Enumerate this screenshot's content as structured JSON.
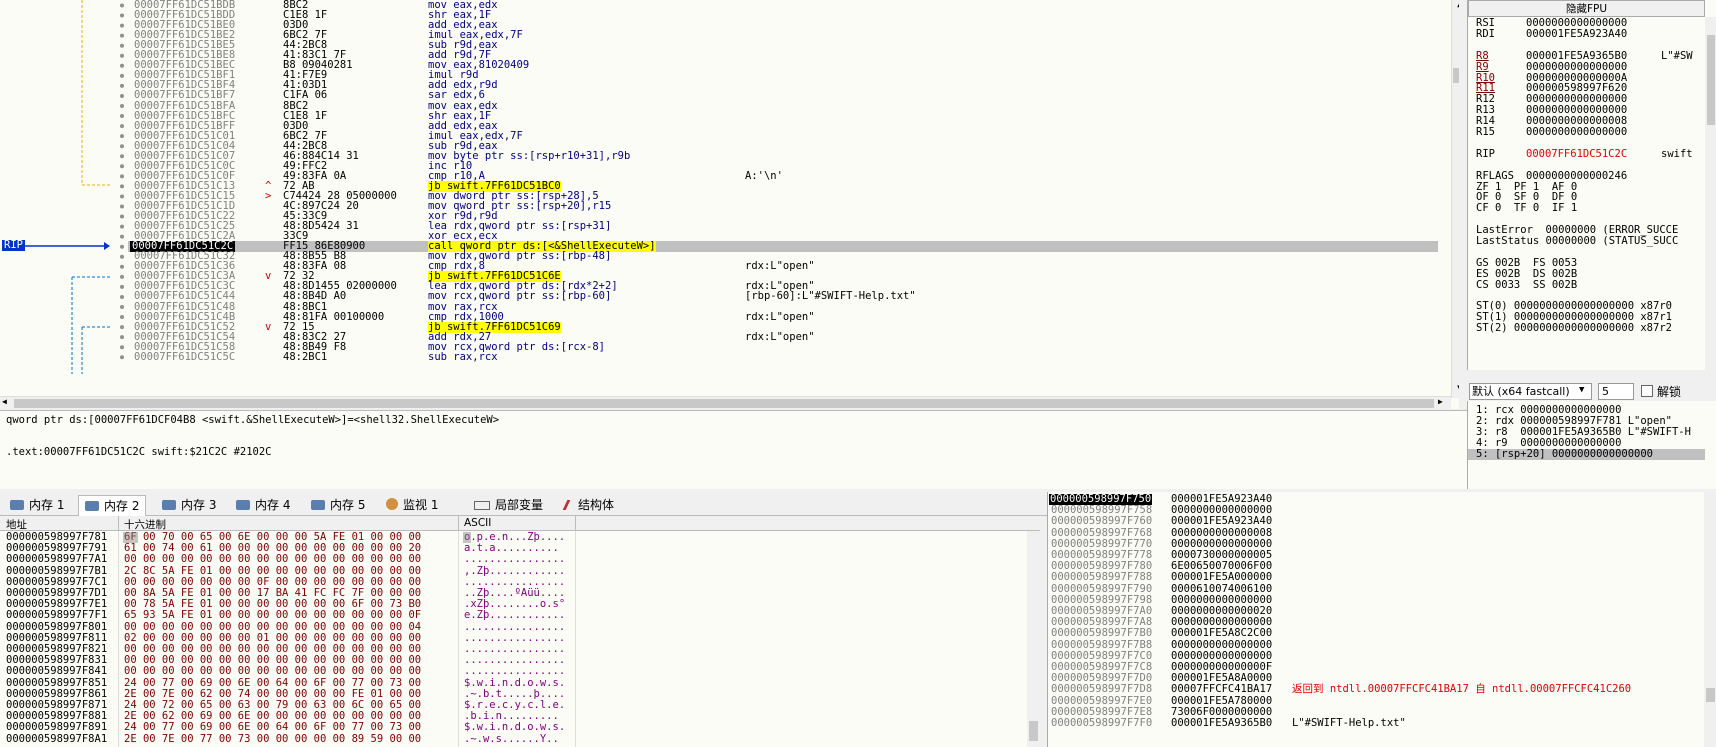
{
  "disasm": {
    "rows": [
      {
        "addr": "00007FF61DC51BDB",
        "mark": "",
        "bytes": "8BC2",
        "ins": "mov eax,edx",
        "cmt": ""
      },
      {
        "addr": "00007FF61DC51BDD",
        "mark": "",
        "bytes": "C1E8 1F",
        "ins": "shr eax,1F",
        "cmt": ""
      },
      {
        "addr": "00007FF61DC51BE0",
        "mark": "",
        "bytes": "03D0",
        "ins": "add edx,eax",
        "cmt": ""
      },
      {
        "addr": "00007FF61DC51BE2",
        "mark": "",
        "bytes": "6BC2 7F",
        "ins": "imul eax,edx,7F",
        "cmt": ""
      },
      {
        "addr": "00007FF61DC51BE5",
        "mark": "",
        "bytes": "44:2BC8",
        "ins": "sub r9d,eax",
        "cmt": ""
      },
      {
        "addr": "00007FF61DC51BE8",
        "mark": "",
        "bytes": "41:83C1 7F",
        "ins": "add r9d,7F",
        "cmt": ""
      },
      {
        "addr": "00007FF61DC51BEC",
        "mark": "",
        "bytes": "B8 09040281",
        "ins": "mov eax,81020409",
        "cmt": ""
      },
      {
        "addr": "00007FF61DC51BF1",
        "mark": "",
        "bytes": "41:F7E9",
        "ins": "imul r9d",
        "cmt": ""
      },
      {
        "addr": "00007FF61DC51BF4",
        "mark": "",
        "bytes": "41:03D1",
        "ins": "add edx,r9d",
        "cmt": ""
      },
      {
        "addr": "00007FF61DC51BF7",
        "mark": "",
        "bytes": "C1FA 06",
        "ins": "sar edx,6",
        "cmt": ""
      },
      {
        "addr": "00007FF61DC51BFA",
        "mark": "",
        "bytes": "8BC2",
        "ins": "mov eax,edx",
        "cmt": ""
      },
      {
        "addr": "00007FF61DC51BFC",
        "mark": "",
        "bytes": "C1E8 1F",
        "ins": "shr eax,1F",
        "cmt": ""
      },
      {
        "addr": "00007FF61DC51BFF",
        "mark": "",
        "bytes": "03D0",
        "ins": "add edx,eax",
        "cmt": ""
      },
      {
        "addr": "00007FF61DC51C01",
        "mark": "",
        "bytes": "6BC2 7F",
        "ins": "imul eax,edx,7F",
        "cmt": ""
      },
      {
        "addr": "00007FF61DC51C04",
        "mark": "",
        "bytes": "44:2BC8",
        "ins": "sub r9d,eax",
        "cmt": ""
      },
      {
        "addr": "00007FF61DC51C07",
        "mark": "",
        "bytes": "46:884C14 31",
        "ins": "mov byte ptr ss:[rsp+r10+31],r9b",
        "cmt": ""
      },
      {
        "addr": "00007FF61DC51C0C",
        "mark": "",
        "bytes": "49:FFC2",
        "ins": "inc r10",
        "cmt": ""
      },
      {
        "addr": "00007FF61DC51C0F",
        "mark": "",
        "bytes": "49:83FA 0A",
        "ins": "cmp r10,A",
        "cmt": "A:'\\n'"
      },
      {
        "addr": "00007FF61DC51C13",
        "mark": "^",
        "bytes": "72 AB",
        "ins": "jb swift.7FF61DC51BC0",
        "cmt": "",
        "jb": true
      },
      {
        "addr": "00007FF61DC51C15",
        "mark": ">",
        "bytes": "C74424 28 05000000",
        "ins": "mov dword ptr ss:[rsp+28],5",
        "cmt": ""
      },
      {
        "addr": "00007FF61DC51C1D",
        "mark": "",
        "bytes": "4C:897C24 20",
        "ins": "mov qword ptr ss:[rsp+20],r15",
        "cmt": ""
      },
      {
        "addr": "00007FF61DC51C22",
        "mark": "",
        "bytes": "45:33C9",
        "ins": "xor r9d,r9d",
        "cmt": ""
      },
      {
        "addr": "00007FF61DC51C25",
        "mark": "",
        "bytes": "48:8D5424 31",
        "ins": "lea rdx,qword ptr ss:[rsp+31]",
        "cmt": ""
      },
      {
        "addr": "00007FF61DC51C2A",
        "mark": "",
        "bytes": "33C9",
        "ins": "xor ecx,ecx",
        "cmt": ""
      },
      {
        "addr": "00007FF61DC51C2C",
        "mark": "",
        "bytes": "FF15 86E80900",
        "ins": "call qword ptr ds:[<&ShellExecuteW>]",
        "cmt": "",
        "cur": true
      },
      {
        "addr": "00007FF61DC51C32",
        "mark": "",
        "bytes": "48:8B55 B8",
        "ins": "mov rdx,qword ptr ss:[rbp-48]",
        "cmt": ""
      },
      {
        "addr": "00007FF61DC51C36",
        "mark": "",
        "bytes": "48:83FA 08",
        "ins": "cmp rdx,8",
        "cmt": "rdx:L\"open\""
      },
      {
        "addr": "00007FF61DC51C3A",
        "mark": "v",
        "bytes": "72 32",
        "ins": "jb swift.7FF61DC51C6E",
        "cmt": "",
        "jb": true
      },
      {
        "addr": "00007FF61DC51C3C",
        "mark": "",
        "bytes": "48:8D1455 02000000",
        "ins": "lea rdx,qword ptr ds:[rdx*2+2]",
        "cmt": "rdx:L\"open\""
      },
      {
        "addr": "00007FF61DC51C44",
        "mark": "",
        "bytes": "48:8B4D A0",
        "ins": "mov rcx,qword ptr ss:[rbp-60]",
        "cmt": "[rbp-60]:L\"#SWIFT-Help.txt\""
      },
      {
        "addr": "00007FF61DC51C48",
        "mark": "",
        "bytes": "48:8BC1",
        "ins": "mov rax,rcx",
        "cmt": ""
      },
      {
        "addr": "00007FF61DC51C4B",
        "mark": "",
        "bytes": "48:81FA 00100000",
        "ins": "cmp rdx,1000",
        "cmt": "rdx:L\"open\""
      },
      {
        "addr": "00007FF61DC51C52",
        "mark": "v",
        "bytes": "72 15",
        "ins": "jb swift.7FF61DC51C69",
        "cmt": "",
        "jb": true
      },
      {
        "addr": "00007FF61DC51C54",
        "mark": "",
        "bytes": "48:83C2 27",
        "ins": "add rdx,27",
        "cmt": "rdx:L\"open\""
      },
      {
        "addr": "00007FF61DC51C58",
        "mark": "",
        "bytes": "48:8B49 F8",
        "ins": "mov rcx,qword ptr ds:[rcx-8]",
        "cmt": ""
      },
      {
        "addr": "00007FF61DC51C5C",
        "mark": "",
        "bytes": "48:2BC1",
        "ins": "sub rax,rcx",
        "cmt": ""
      }
    ],
    "rip_label": "RIP"
  },
  "info": {
    "line1": "qword ptr ds:[00007FF61DCF04B8 <swift.&ShellExecuteW>]=<shell32.ShellExecuteW>",
    "line2": ".text:00007FF61DC51C2C swift:$21C2C #2102C"
  },
  "registers": {
    "fpu_button": "隐藏FPU",
    "rows": [
      {
        "n": "RSI",
        "v": "0000000000000000",
        "c": ""
      },
      {
        "n": "RDI",
        "v": "000001FE5A923A40",
        "c": ""
      },
      {
        "n": "",
        "v": "",
        "c": ""
      },
      {
        "n": "R8",
        "v": "000001FE5A9365B0",
        "c": "L\"#SW",
        "ul": true
      },
      {
        "n": "R9",
        "v": "0000000000000000",
        "c": "",
        "ul": true
      },
      {
        "n": "R10",
        "v": "000000000000000A",
        "c": "",
        "ul": true
      },
      {
        "n": "R11",
        "v": "000000598997F620",
        "c": "",
        "ul": true
      },
      {
        "n": "R12",
        "v": "0000000000000000",
        "c": ""
      },
      {
        "n": "R13",
        "v": "0000000000000000",
        "c": ""
      },
      {
        "n": "R14",
        "v": "0000000000000008",
        "c": ""
      },
      {
        "n": "R15",
        "v": "0000000000000000",
        "c": ""
      },
      {
        "n": "",
        "v": "",
        "c": ""
      },
      {
        "n": "RIP",
        "v": "00007FF61DC51C2C",
        "c": "swift",
        "red": true
      },
      {
        "n": "",
        "v": "",
        "c": ""
      },
      {
        "n": "RFLAGS",
        "v": "0000000000000246",
        "c": ""
      },
      {
        "n": "ZF 1  PF 1  AF 0",
        "v": "",
        "c": "",
        "raw": true
      },
      {
        "n": "OF 0  SF 0  DF 0",
        "v": "",
        "c": "",
        "raw": true
      },
      {
        "n": "CF 0  TF 0  IF 1",
        "v": "",
        "c": "",
        "raw": true
      },
      {
        "n": "",
        "v": "",
        "c": ""
      },
      {
        "n": "LastError  00000000 (ERROR_SUCCE",
        "v": "",
        "c": "",
        "raw": true
      },
      {
        "n": "LastStatus 00000000 (STATUS_SUCC",
        "v": "",
        "c": "",
        "raw": true
      },
      {
        "n": "",
        "v": "",
        "c": ""
      },
      {
        "n": "GS 002B  FS 0053",
        "v": "",
        "c": "",
        "raw": true
      },
      {
        "n": "ES 002B  DS 002B",
        "v": "",
        "c": "",
        "raw": true
      },
      {
        "n": "CS 0033  SS 002B",
        "v": "",
        "c": "",
        "raw": true
      },
      {
        "n": "",
        "v": "",
        "c": ""
      },
      {
        "n": "ST(0) 0000000000000000000 x87r0",
        "v": "",
        "c": "",
        "raw": true
      },
      {
        "n": "ST(1) 0000000000000000000 x87r1",
        "v": "",
        "c": "",
        "raw": true
      },
      {
        "n": "ST(2) 0000000000000000000 x87r2",
        "v": "",
        "c": "",
        "raw": true
      }
    ]
  },
  "callconv": {
    "select": "默认 (x64 fastcall)",
    "count": "5",
    "unlock_label": "解锁"
  },
  "stackargs": [
    "1: rcx 0000000000000000",
    "2: rdx 000000598997F781 L\"open\"",
    "3: r8  000001FE5A9365B0 L\"#SWIFT-H",
    "4: r9  0000000000000000",
    "5: [rsp+20] 0000000000000000"
  ],
  "tabs": [
    {
      "label": "内存 1",
      "icon": "memory-icon"
    },
    {
      "label": "内存 2",
      "icon": "memory-icon",
      "active": true
    },
    {
      "label": "内存 3",
      "icon": "memory-icon"
    },
    {
      "label": "内存 4",
      "icon": "memory-icon"
    },
    {
      "label": "内存 5",
      "icon": "memory-icon"
    },
    {
      "label": "监视 1",
      "icon": "watch-icon"
    },
    {
      "label": "局部变量",
      "icon": "locals-icon",
      "prefix": "[x=]"
    },
    {
      "label": "结构体",
      "icon": "struct-icon"
    }
  ],
  "dump": {
    "headers": {
      "addr": "地址",
      "hex": "十六进制",
      "ascii": "ASCII"
    },
    "rows": [
      {
        "a": "000000598997F781",
        "h": "6F 00 70 00 65 00 6E 00 00 00 5A FE 01 00 00 00",
        "t": "o.p.e.n...Zþ...."
      },
      {
        "a": "000000598997F791",
        "h": "61 00 74 00 61 00 00 00 00 00 00 00 00 00 00 20",
        "t": "a.t.a.......... "
      },
      {
        "a": "000000598997F7A1",
        "h": "00 00 00 00 00 00 00 00 00 00 00 00 00 00 00 00",
        "t": "................"
      },
      {
        "a": "000000598997F7B1",
        "h": "2C 8C 5A FE 01 00 00 00 00 00 00 00 00 00 00 00",
        "t": ",.Zþ............"
      },
      {
        "a": "000000598997F7C1",
        "h": "00 00 00 00 00 00 00 0F 00 00 00 00 00 00 00 00",
        "t": "................"
      },
      {
        "a": "000000598997F7D1",
        "h": "00 8A 5A FE 01 00 00 17 BA 41 FC FC 7F 00 00 00",
        "t": "..Zþ....ºAüü...."
      },
      {
        "a": "000000598997F7E1",
        "h": "00 78 5A FE 01 00 00 00 00 00 00 00 6F 00 73 B0",
        "t": ".xZþ........o.s°"
      },
      {
        "a": "000000598997F7F1",
        "h": "65 93 5A FE 01 00 00 00 00 00 00 00 00 00 00 0F",
        "t": "e.Zþ............"
      },
      {
        "a": "000000598997F801",
        "h": "00 00 00 00 00 00 00 00 00 00 00 00 00 00 00 04",
        "t": "................"
      },
      {
        "a": "000000598997F811",
        "h": "02 00 00 00 00 00 00 01 00 00 00 00 00 00 00 00",
        "t": "................"
      },
      {
        "a": "000000598997F821",
        "h": "00 00 00 00 00 00 00 00 00 00 00 00 00 00 00 00",
        "t": "................"
      },
      {
        "a": "000000598997F831",
        "h": "00 00 00 00 00 00 00 00 00 00 00 00 00 00 00 00",
        "t": "................"
      },
      {
        "a": "000000598997F841",
        "h": "00 00 00 00 00 00 00 00 00 00 00 00 00 00 00 00",
        "t": "................"
      },
      {
        "a": "000000598997F851",
        "h": "24 00 77 00 69 00 6E 00 64 00 6F 00 77 00 73 00",
        "t": "$.w.i.n.d.o.w.s."
      },
      {
        "a": "000000598997F861",
        "h": "2E 00 7E 00 62 00 74 00 00 00 00 00 FE 01 00 00",
        "t": ".~.b.t.....þ...."
      },
      {
        "a": "000000598997F871",
        "h": "24 00 72 00 65 00 63 00 79 00 63 00 6C 00 65 00",
        "t": "$.r.e.c.y.c.l.e."
      },
      {
        "a": "000000598997F881",
        "h": "2E 00 62 00 69 00 6E 00 00 00 00 00 00 00 00 00",
        "t": ".b.i.n........."
      },
      {
        "a": "000000598997F891",
        "h": "24 00 77 00 69 00 6E 00 64 00 6F 00 77 00 73 00",
        "t": "$.w.i.n.d.o.w.s."
      },
      {
        "a": "000000598997F8A1",
        "h": "2E 00 7E 00 77 00 73 00 00 00 00 00 89 59 00 00",
        "t": ".~.w.s......Y.."
      }
    ]
  },
  "stack": {
    "rows": [
      {
        "a": "000000598997F750",
        "v": "000001FE5A923A40",
        "c": "",
        "top": true
      },
      {
        "a": "000000598997F758",
        "v": "0000000000000000",
        "c": ""
      },
      {
        "a": "000000598997F760",
        "v": "000001FE5A923A40",
        "c": ""
      },
      {
        "a": "000000598997F768",
        "v": "0000000000000008",
        "c": ""
      },
      {
        "a": "000000598997F770",
        "v": "0000000000000000",
        "c": ""
      },
      {
        "a": "000000598997F778",
        "v": "0000730000000005",
        "c": ""
      },
      {
        "a": "000000598997F780",
        "v": "6E00650070006F00",
        "c": ""
      },
      {
        "a": "000000598997F788",
        "v": "000001FE5A000000",
        "c": ""
      },
      {
        "a": "000000598997F790",
        "v": "0000610074006100",
        "c": ""
      },
      {
        "a": "000000598997F798",
        "v": "0000000000000000",
        "c": ""
      },
      {
        "a": "000000598997F7A0",
        "v": "0000000000000020",
        "c": ""
      },
      {
        "a": "000000598997F7A8",
        "v": "0000000000000000",
        "c": ""
      },
      {
        "a": "000000598997F7B0",
        "v": "000001FE5A8C2C00",
        "c": ""
      },
      {
        "a": "000000598997F7B8",
        "v": "0000000000000000",
        "c": ""
      },
      {
        "a": "000000598997F7C0",
        "v": "0000000000000000",
        "c": ""
      },
      {
        "a": "000000598997F7C8",
        "v": "000000000000000F",
        "c": ""
      },
      {
        "a": "000000598997F7D0",
        "v": "000001FE5A8A0000",
        "c": ""
      },
      {
        "a": "000000598997F7D8",
        "v": "00007FFCFC41BA17",
        "c": "返回到 ntdll.00007FFCFC41BA17 自 ntdll.00007FFCFC41C260",
        "red": true
      },
      {
        "a": "000000598997F7E0",
        "v": "000001FE5A780000",
        "c": ""
      },
      {
        "a": "000000598997F7E8",
        "v": "73006F0000000000",
        "c": ""
      },
      {
        "a": "000000598997F7F0",
        "v": "000001FE5A9365B0",
        "c": "L\"#SWIFT-Help.txt\""
      }
    ]
  },
  "colors": {
    "accent_jb": "#ffff00",
    "cur_line": "#c0c0c0",
    "red": "#e00000"
  }
}
